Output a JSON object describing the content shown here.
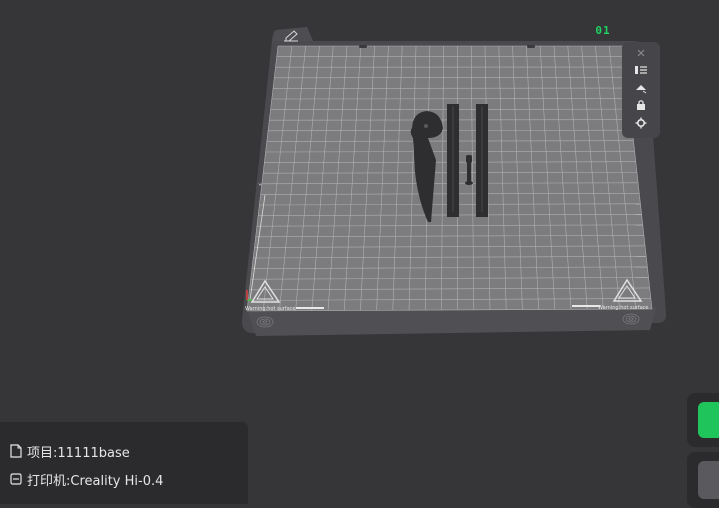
{
  "plate": {
    "index_label": "01",
    "warning_left": "Warning:hot surface",
    "warning_right": "Warning:hot surface"
  },
  "toolbar": {
    "edit_icon": "pencil-icon",
    "close_icon": "close-icon",
    "tools": [
      {
        "name": "arrange-objects-button",
        "icon": "list-icon"
      },
      {
        "name": "auto-orient-button",
        "icon": "orient-icon"
      },
      {
        "name": "lock-plate-button",
        "icon": "lock-icon"
      },
      {
        "name": "plate-settings-button",
        "icon": "gear-icon"
      }
    ]
  },
  "project": {
    "label": "项目:11111base",
    "icon": "file-icon"
  },
  "printer": {
    "label": "打印机:Creality Hi-0.4",
    "icon": "printer-icon"
  },
  "colors": {
    "background": "#363638",
    "plate_frame": "#4a4a4e",
    "plate_bed": "#7e7e80",
    "grid": "#b4b4b6",
    "accent_green": "#1fd161",
    "panel": "#2b2b2d"
  }
}
